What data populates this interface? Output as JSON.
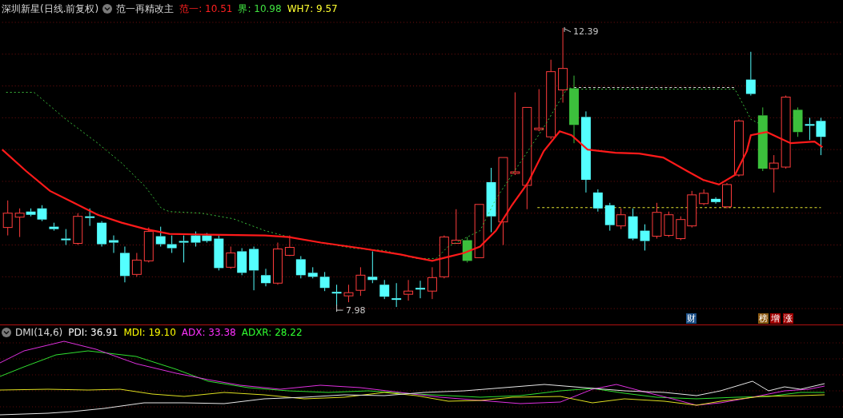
{
  "chart_header": {
    "title": "深圳新星(日线.前复权)",
    "indicator": "范一再精改主",
    "legend": [
      {
        "text": "范一: 10.51",
        "color": "#ff2020"
      },
      {
        "text": "界: 10.98",
        "color": "#40e040"
      },
      {
        "text": "WH7: 9.57",
        "color": "#ffff30"
      }
    ]
  },
  "price_labels": {
    "high": "12.39",
    "low": "7.98"
  },
  "event_badges": [
    {
      "text": "财",
      "color": "#1c4f86"
    },
    {
      "text": "榜",
      "color": "#8c5a12"
    },
    {
      "text": "增",
      "color": "#a00000"
    },
    {
      "text": "涨",
      "color": "#a00000"
    }
  ],
  "dmi_header": {
    "title": "DMI(14,6)",
    "legend": [
      {
        "text": "PDI: 36.91",
        "color": "#ffffff"
      },
      {
        "text": "MDI: 19.10",
        "color": "#ffff00"
      },
      {
        "text": "ADX: 33.38",
        "color": "#ff30ff"
      },
      {
        "text": "ADXR: 28.22",
        "color": "#30ff30"
      }
    ]
  }
}
